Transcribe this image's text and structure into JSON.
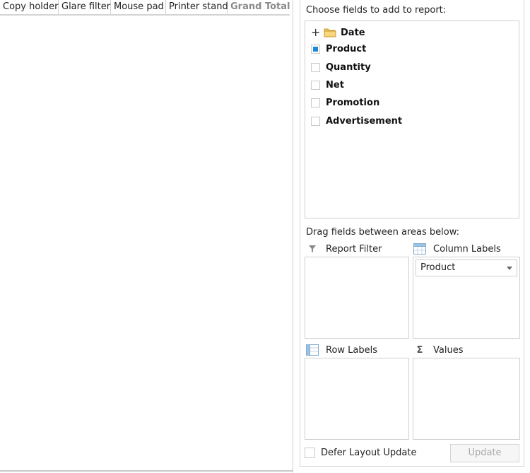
{
  "pivot_grid": {
    "column_headers": [
      "Copy holder",
      "Glare filter",
      "Mouse pad",
      "Printer stand"
    ],
    "grand_total": "Grand Total"
  },
  "field_list": {
    "choose_label": "Choose fields to add to report:",
    "fields": [
      {
        "name": "Date",
        "type": "folder",
        "checked": false
      },
      {
        "name": "Product",
        "type": "field",
        "checked": true
      },
      {
        "name": "Quantity",
        "type": "field",
        "checked": false
      },
      {
        "name": "Net",
        "type": "field",
        "checked": false
      },
      {
        "name": "Promotion",
        "type": "field",
        "checked": false
      },
      {
        "name": "Advertisement",
        "type": "field",
        "checked": false
      }
    ],
    "drag_label": "Drag fields between areas below:",
    "areas": {
      "report_filter": {
        "title": "Report Filter",
        "icon": "filter-icon"
      },
      "column_labels": {
        "title": "Column Labels",
        "icon": "column-labels-icon",
        "items": [
          "Product"
        ]
      },
      "row_labels": {
        "title": "Row Labels",
        "icon": "row-labels-icon"
      },
      "values": {
        "title": "Values",
        "icon": "sigma-icon"
      }
    },
    "defer_label": "Defer Layout Update",
    "update_label": "Update"
  },
  "colors": {
    "accent": "#1e8ad6",
    "border": "#cfcfcf",
    "disabled_text": "#a8a8a8"
  }
}
